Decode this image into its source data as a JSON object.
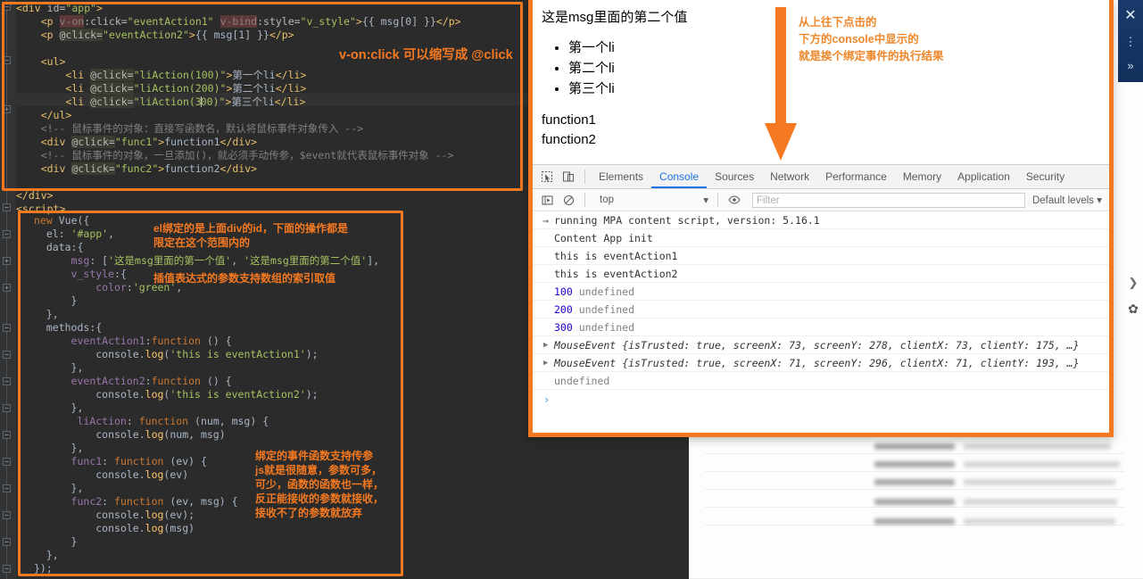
{
  "editor": {
    "html_block": {
      "lines": [
        "<div id=\"app\">",
        "    <p v-on:click=\"eventAction1\" v-bind:style=\"v_style\">{{ msg[0] }}</p>",
        "    <p @click=\"eventAction2\">{{ msg[1] }}</p>",
        "",
        "    <ul>",
        "        <li @click=\"liAction(100)\">第一个li</li>",
        "        <li @click=\"liAction(200)\">第二个li</li>",
        "        <li @click=\"liAction(300)\">第三个li</li>",
        "    </ul>",
        "    <!-- 鼠标事件的对象：直接写函数名，默认将鼠标事件对象传入 -->",
        "    <div @click=\"func1\">function1</div>",
        "    <!-- 鼠标事件的对象，一旦添加()，就必须手动传参，$event就代表鼠标事件对象 -->",
        "    <div @click=\"func2\">function2</div>",
        "",
        "</div>"
      ]
    },
    "script_tag": "<script>",
    "js_block": {
      "lines": [
        "new Vue({",
        "    el: '#app',",
        "    data:{",
        "        msg: ['这是msg里面的第一个值', '这是msg里面的第二个值'],",
        "        v_style:{",
        "            color:'green',",
        "        }",
        "    },",
        "    methods:{",
        "        eventAction1:function () {",
        "            console.log('this is eventAction1');",
        "        },",
        "        eventAction2:function () {",
        "            console.log('this is eventAction2');",
        "        },",
        "        liAction: function (num, msg) {",
        "            console.log(num, msg)",
        "        },",
        "        func1: function (ev) {",
        "            console.log(ev)",
        "        },",
        "        func2: function (ev, msg) {",
        "            console.log(ev);",
        "            console.log(msg)",
        "        }",
        "    },",
        "});"
      ]
    },
    "annotations": {
      "shorthand": "v-on:click 可以缩写成 @click",
      "el_binding": "el绑定的是上面div的id，下面的操作都是\n限定在这个范围内的",
      "interpolation": "插值表达式的参数支持数组的索引取值",
      "params": "绑定的事件函数支持传参\njs就是很随意，参数可多，\n可少，函数的函数也一样，\n反正能接收的参数就接收，\n接收不了的参数就放弃"
    }
  },
  "browser": {
    "page": {
      "heading": "这是msg里面的第二个值",
      "list_items": [
        "第一个li",
        "第二个li",
        "第三个li"
      ],
      "div1": "function1",
      "div2": "function2"
    },
    "arrow_annotation": "从上往下点击的\n下方的console中显示的\n就是挨个绑定事件的执行结果"
  },
  "devtools": {
    "left_icons": [
      "inspect-element-icon",
      "device-toolbar-icon"
    ],
    "tabs": [
      {
        "label": "Elements",
        "active": false
      },
      {
        "label": "Console",
        "active": true
      },
      {
        "label": "Sources",
        "active": false
      },
      {
        "label": "Network",
        "active": false
      },
      {
        "label": "Performance",
        "active": false
      },
      {
        "label": "Memory",
        "active": false
      },
      {
        "label": "Application",
        "active": false
      },
      {
        "label": "Security",
        "active": false
      }
    ],
    "filterbar": {
      "execute_icon": "execute-sidebar-icon",
      "clear_icon": "clear-console-icon",
      "context": "top",
      "eye_icon": "live-expression-icon",
      "filter_placeholder": "Filter",
      "levels": "Default levels"
    },
    "console_lines": [
      {
        "kind": "info",
        "marker": "→",
        "text": "running MPA content script, version: 5.16.1"
      },
      {
        "kind": "plain",
        "marker": "",
        "text": "Content App init"
      },
      {
        "kind": "plain",
        "marker": "",
        "text": "this is eventAction1"
      },
      {
        "kind": "plain",
        "marker": "",
        "text": "this is eventAction2"
      },
      {
        "kind": "numundef",
        "marker": "",
        "num": "100",
        "text": "undefined"
      },
      {
        "kind": "numundef",
        "marker": "",
        "num": "200",
        "text": "undefined"
      },
      {
        "kind": "numundef",
        "marker": "",
        "num": "300",
        "text": "undefined"
      },
      {
        "kind": "object",
        "marker": "▶",
        "name": "MouseEvent",
        "props": "{isTrusted: true, screenX: 73, screenY: 278, clientX: 73, clientY: 175, …}"
      },
      {
        "kind": "object",
        "marker": "▶",
        "name": "MouseEvent",
        "props": "{isTrusted: true, screenX: 71, screenY: 296, clientX: 71, clientY: 193, …}"
      },
      {
        "kind": "undef",
        "marker": "",
        "text": "undefined"
      }
    ],
    "prompt": "›"
  },
  "blue_sidebar": {
    "close_icon": "close-icon",
    "menu_icon": "more-options-icon",
    "expand_icon": "expand-right-icon"
  },
  "right_edge": {
    "chevron_icon": "chevron-right-icon",
    "gear_icon": "gear-icon"
  },
  "colors": {
    "accent_orange": "#f47920",
    "editor_bg": "#2b2b2b",
    "devtools_blue": "#1a73e8",
    "blue_sidebar": "#1a3a6b"
  }
}
